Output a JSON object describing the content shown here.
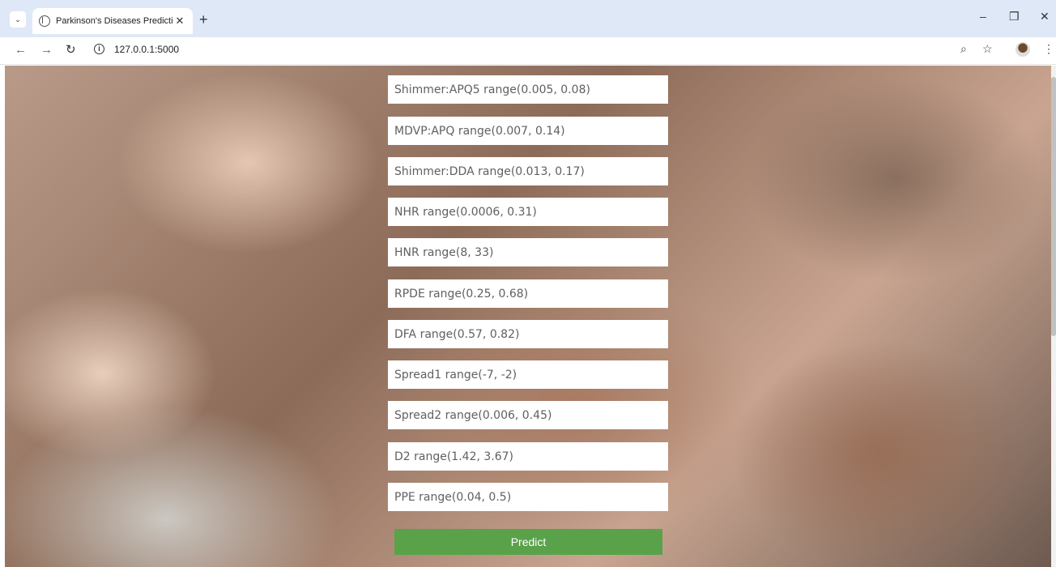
{
  "browser": {
    "tab_title": "Parkinson's Diseases Prediction",
    "tab_close": "✕",
    "new_tab": "+",
    "url": "127.0.0.1:5000",
    "back": "←",
    "forward": "→",
    "reload": "↻",
    "zoom": "⌕",
    "bookmark": "☆",
    "menu": "⋮",
    "minimize": "–",
    "restore": "❐",
    "close": "✕",
    "tab_search": "⌄",
    "info": "i"
  },
  "form": {
    "fields": [
      {
        "placeholder": "Shimmer:APQ5 range(0.005, 0.08)"
      },
      {
        "placeholder": "MDVP:APQ range(0.007, 0.14)"
      },
      {
        "placeholder": "Shimmer:DDA range(0.013, 0.17)"
      },
      {
        "placeholder": "NHR range(0.0006, 0.31)"
      },
      {
        "placeholder": "HNR range(8, 33)"
      },
      {
        "placeholder": "RPDE range(0.25, 0.68)"
      },
      {
        "placeholder": "DFA range(0.57, 0.82)"
      },
      {
        "placeholder": "Spread1 range(-7, -2)"
      },
      {
        "placeholder": "Spread2 range(0.006, 0.45)"
      },
      {
        "placeholder": "D2 range(1.42, 3.67)"
      },
      {
        "placeholder": "PPE range(0.04, 0.5)"
      }
    ],
    "submit_label": "Predict"
  },
  "colors": {
    "accent": "#5aa24a",
    "tabstrip": "#dfe8f7"
  }
}
